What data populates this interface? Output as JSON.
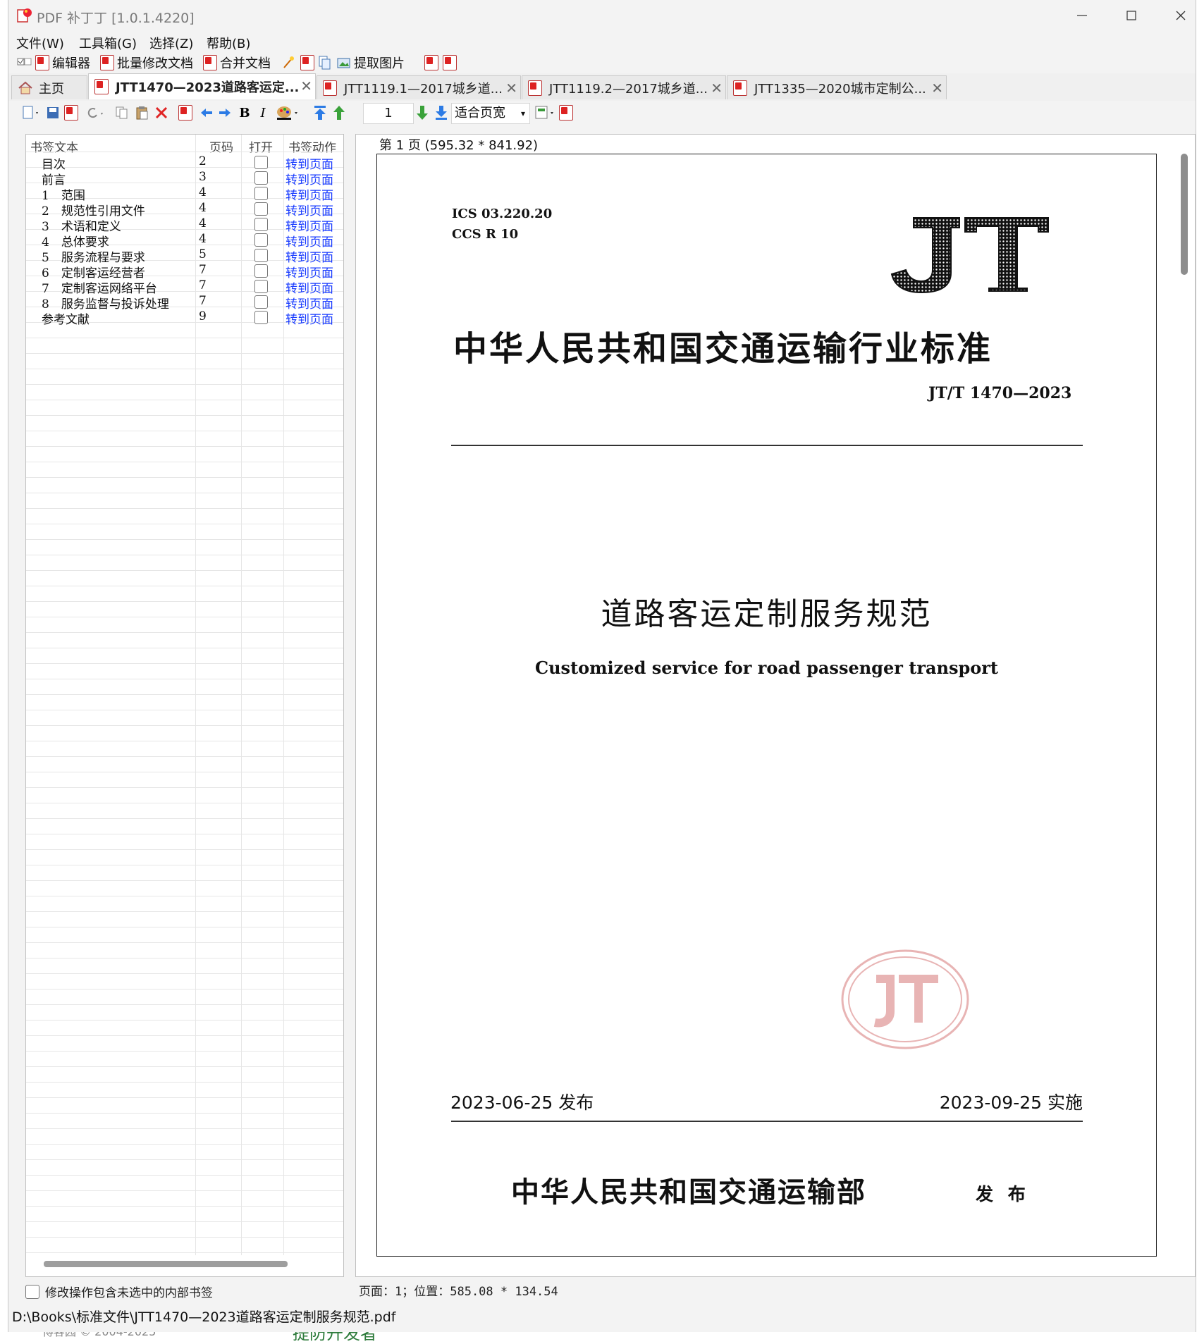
{
  "window": {
    "title": "PDF 补丁丁 [1.0.1.4220]"
  },
  "menu": [
    "文件(W)",
    "工具箱(G)",
    "选择(Z)",
    "帮助(B)"
  ],
  "toolbar1": {
    "editor": "编辑器",
    "batch_modify": "批量修改文档",
    "merge": "合并文档",
    "extract_images": "提取图片"
  },
  "tabs": [
    {
      "label": "主页",
      "icon": "home-icon"
    },
    {
      "label": "JTT1470—2023道路客运定...",
      "icon": "pdf-icon",
      "active": true
    },
    {
      "label": "JTT1119.1—2017城乡道...",
      "icon": "pdf-icon"
    },
    {
      "label": "JTT1119.2—2017城乡道...",
      "icon": "pdf-icon"
    },
    {
      "label": "JTT1335—2020城市定制公...",
      "icon": "pdf-icon"
    }
  ],
  "toolbar2": {
    "page_number": "1",
    "zoom": "适合页宽"
  },
  "bookmarks": {
    "headers": {
      "text": "书签文本",
      "page": "页码",
      "open": "打开",
      "action": "书签动作"
    },
    "rows": [
      {
        "text": "目次",
        "page": "2",
        "action": "转到页面"
      },
      {
        "text": "前言",
        "page": "3",
        "action": "转到页面"
      },
      {
        "text": "1　范围",
        "page": "4",
        "action": "转到页面"
      },
      {
        "text": "2　规范性引用文件",
        "page": "4",
        "action": "转到页面"
      },
      {
        "text": "3　术语和定义",
        "page": "4",
        "action": "转到页面"
      },
      {
        "text": "4　总体要求",
        "page": "4",
        "action": "转到页面"
      },
      {
        "text": "5　服务流程与要求",
        "page": "5",
        "action": "转到页面"
      },
      {
        "text": "6　定制客运经营者",
        "page": "7",
        "action": "转到页面"
      },
      {
        "text": "7　定制客运网络平台",
        "page": "7",
        "action": "转到页面"
      },
      {
        "text": "8　服务监督与投诉处理",
        "page": "7",
        "action": "转到页面"
      },
      {
        "text": "参考文献",
        "page": "9",
        "action": "转到页面"
      }
    ],
    "footer_checkbox": "修改操作包含未选中的内部书签"
  },
  "viewer": {
    "page_label": "第 1 页 (595.32 * 841.92)",
    "status": "页面：1；位置：585.08 * 134.54"
  },
  "document": {
    "ics": "ICS  03.220.20",
    "ccs": "CCS  R  10",
    "logo": "JT",
    "org_standard": "中华人民共和国交通运输行业标准",
    "std_no": "JT/T  1470—2023",
    "title_cn": "道路客运定制服务规范",
    "title_en": "Customized service for road passenger transport",
    "publish_date": "2023-06-25 发布",
    "effective_date": "2023-09-25 实施",
    "issuer": "中华人民共和国交通运输部",
    "issue_word": "发 布"
  },
  "statusbar": {
    "file_path": "D:\\Books\\标准文件\\JTT1470—2023道路客运定制服务规范.pdf"
  },
  "colors": {
    "link": "#1a3cff",
    "accent_red": "#d22222",
    "stamp": "#e8b4b4"
  }
}
